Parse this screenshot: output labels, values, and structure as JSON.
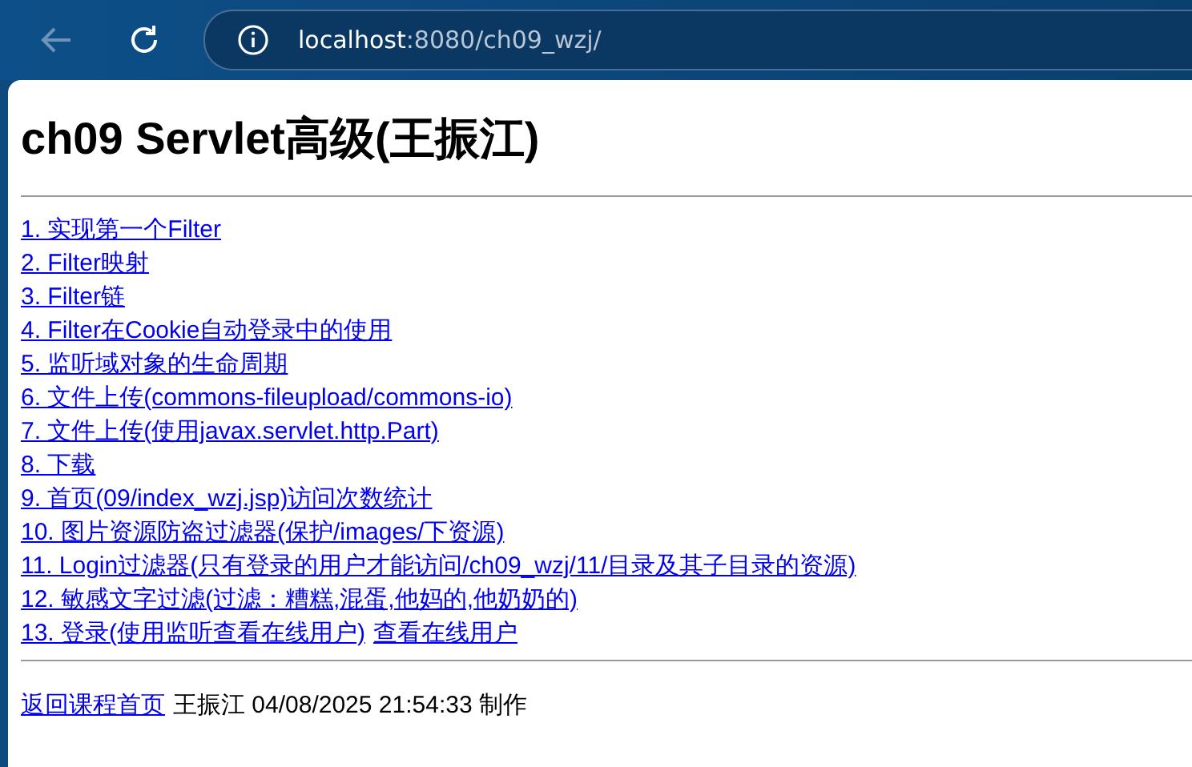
{
  "browser": {
    "url_host": "localhost",
    "url_rest": ":8080/ch09_wzj/"
  },
  "page": {
    "heading": "ch09 Servlet高级(王振江)",
    "links": [
      {
        "parts": [
          "1. 实现第一个Filter"
        ]
      },
      {
        "parts": [
          "2. Filter映射"
        ]
      },
      {
        "parts": [
          "3. Filter链"
        ]
      },
      {
        "parts": [
          "4. Filter在Cookie自动登录中的使用"
        ]
      },
      {
        "parts": [
          "5. 监听域对象的生命周期"
        ]
      },
      {
        "parts": [
          "6. 文件上传(commons-fileupload/commons-io)"
        ]
      },
      {
        "parts": [
          "7. 文件上传(使用javax.servlet.http.Part)"
        ]
      },
      {
        "parts": [
          "8. 下载"
        ]
      },
      {
        "parts": [
          "9. 首页(09/index_wzj.jsp)访问次数统计"
        ]
      },
      {
        "parts": [
          "10. 图片资源防盗过滤器(保护/images/下资源)"
        ]
      },
      {
        "parts": [
          "11. Login过滤器(只有登录的用户才能访问/ch09_wzj/11/目录及其子目录的资源)"
        ]
      },
      {
        "parts": [
          "12. 敏感文字过滤(过滤：糟糕,混蛋,他妈的,他奶奶的)"
        ]
      },
      {
        "parts": [
          "13. 登录(使用监听查看在线用户)",
          "查看在线用户"
        ]
      }
    ],
    "footer": {
      "link": "返回课程首页",
      "text": "王振江 04/08/2025 21:54:33 制作"
    }
  }
}
